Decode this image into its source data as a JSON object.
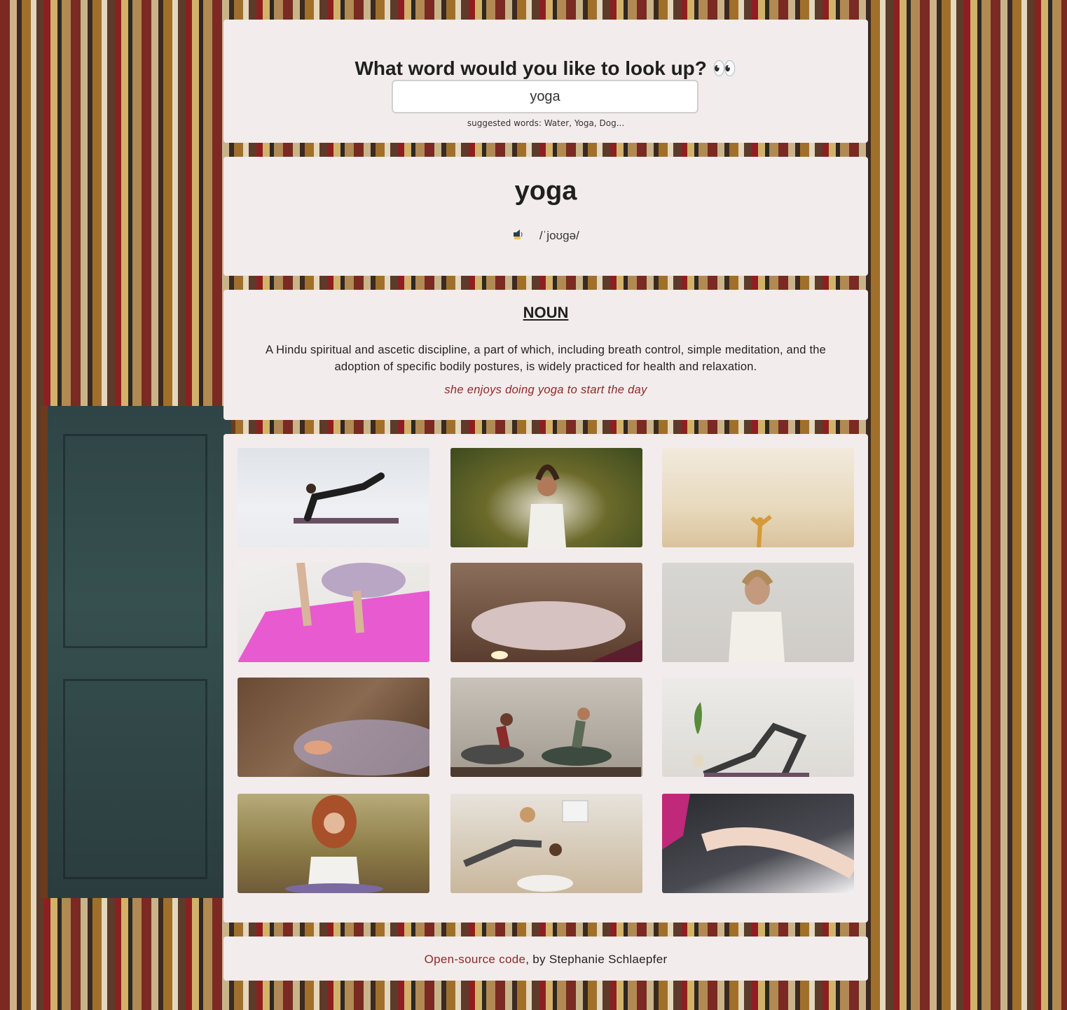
{
  "search": {
    "heading": "What word would you like to look up? 👀",
    "value": "yoga",
    "suggestions": "suggested words: Water, Yoga, Dog..."
  },
  "word": {
    "title": "yoga",
    "phonetic": "/ˈjoʊɡə/",
    "audio_icon": "speaker-icon"
  },
  "meaning": {
    "part_of_speech": "NOUN",
    "definition": "A Hindu spiritual and ascetic discipline, a part of which, including breath control, simple meditation, and the adoption of specific bodily postures, is widely practiced for health and relaxation.",
    "example": "she enjoys doing yoga to start the day"
  },
  "gallery": {
    "image_count": 12
  },
  "footer": {
    "link_text": "Open-source code",
    "author_text": ", by Stephanie Schlaepfer"
  },
  "colors": {
    "panel_bg": "#f3ecec",
    "accent": "#8b2a2a",
    "text": "#222222"
  }
}
